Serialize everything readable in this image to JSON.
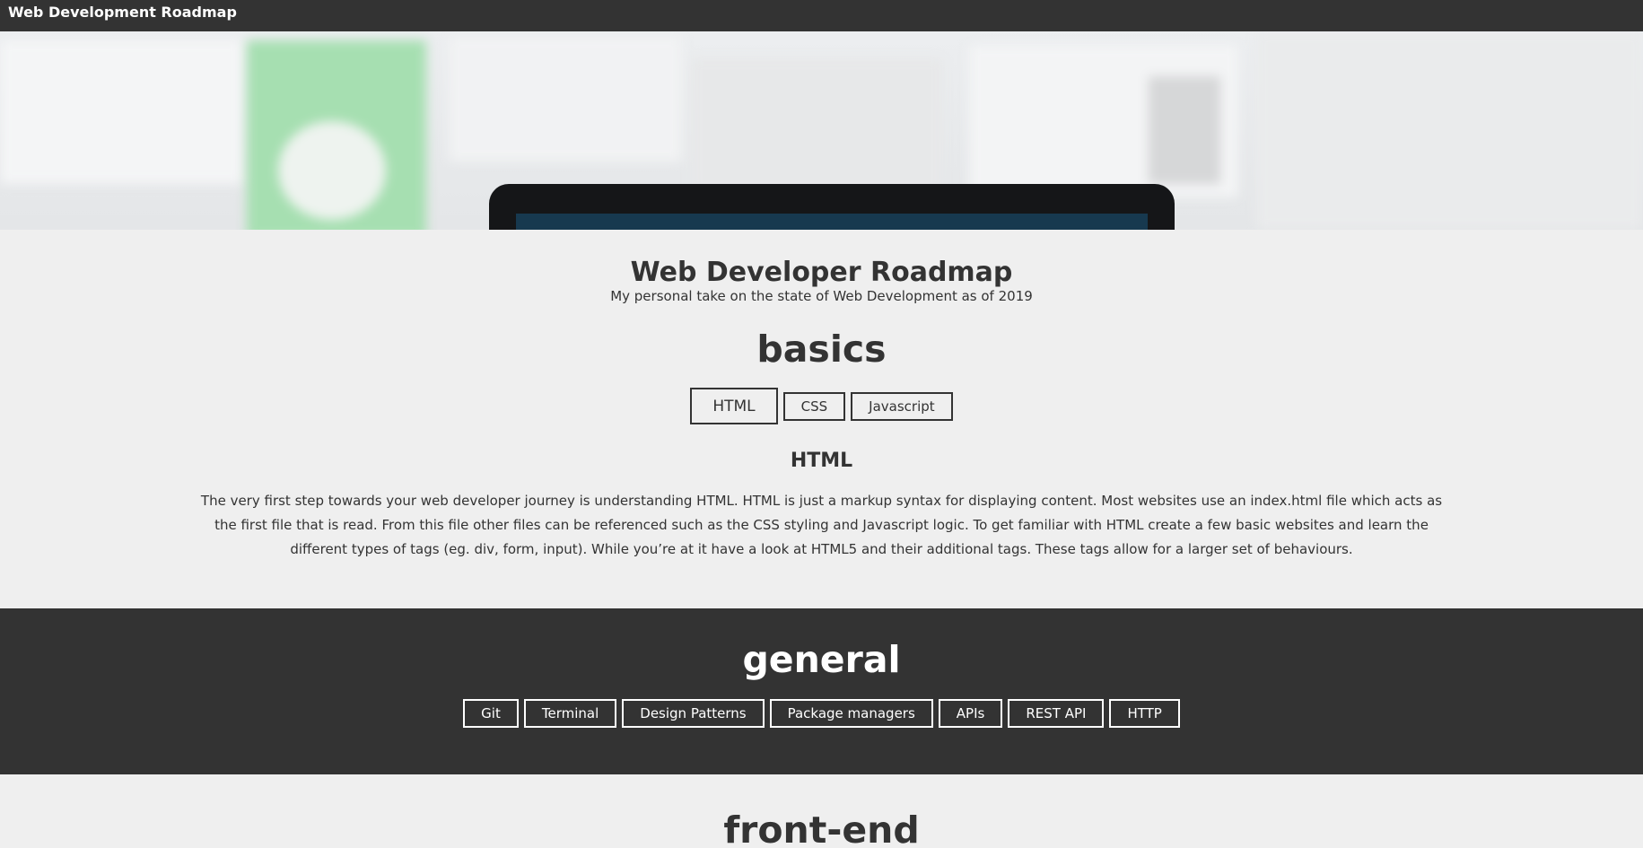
{
  "header": {
    "title": "Web Development Roadmap"
  },
  "intro": {
    "title": "Web Developer Roadmap",
    "subtitle": "My personal take on the state of Web Development as of 2019"
  },
  "basics": {
    "heading": "basics",
    "tabs": [
      "HTML",
      "CSS",
      "Javascript"
    ],
    "active_tab": "HTML",
    "topic_title": "HTML",
    "topic_description": "The very first step towards your web developer journey is understanding HTML. HTML is just a markup syntax for displaying content. Most websites use an index.html file which acts as the first file that is read. From this file other files can be referenced such as the CSS styling and Javascript logic. To get familiar with HTML create a few basic websites and learn the different types of tags (eg. div, form, input). While you’re at it have a look at HTML5 and their additional tags. These tags allow for a larger set of behaviours."
  },
  "general": {
    "heading": "general",
    "tabs": [
      "Git",
      "Terminal",
      "Design Patterns",
      "Package managers",
      "APIs",
      "REST API",
      "HTTP"
    ]
  },
  "frontend": {
    "heading": "front-end"
  },
  "colors": {
    "dark": "#333333",
    "light": "#efefef",
    "hero_green": "#a6dfb1"
  }
}
